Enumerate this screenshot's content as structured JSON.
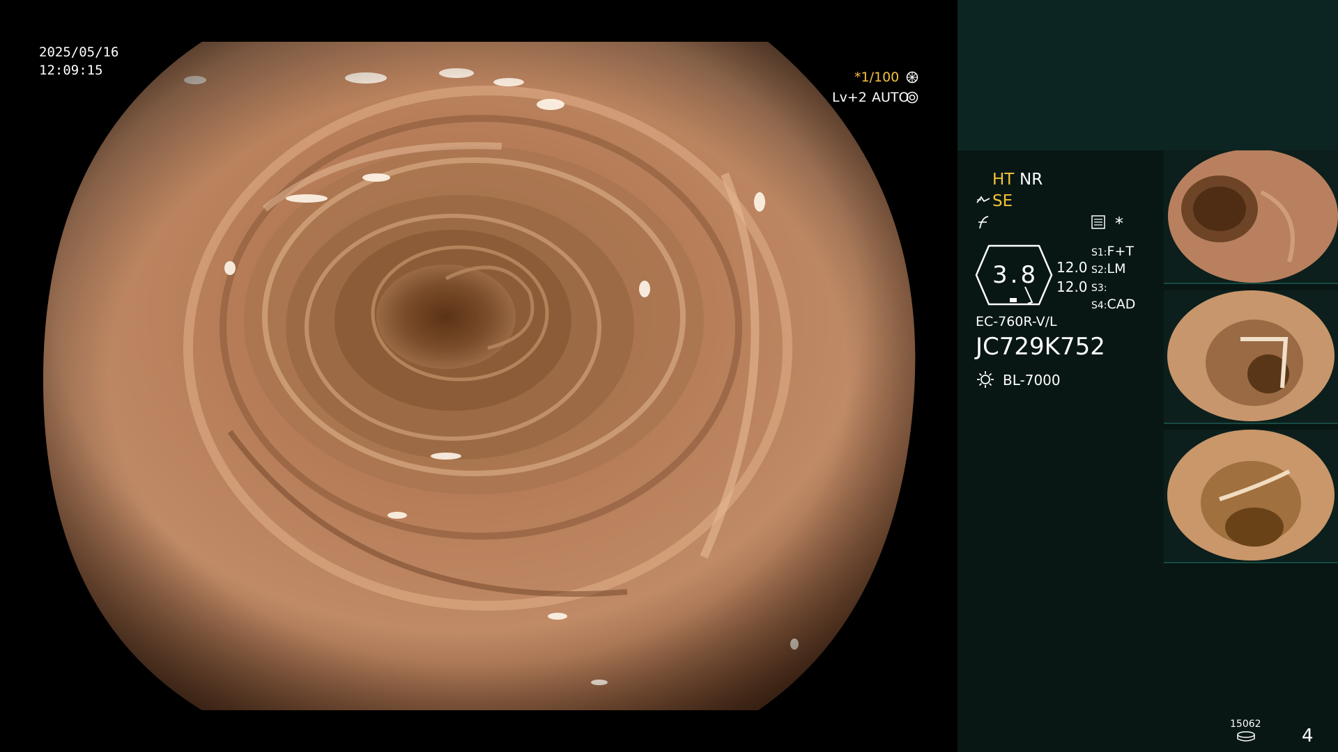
{
  "overlay": {
    "date": "2025/05/16",
    "time": "12:09:15",
    "shutter": "*1/100",
    "level": "Lv+2",
    "auto": "AUTO"
  },
  "modes": {
    "ht": "HT",
    "nr": "NR",
    "se": "SE"
  },
  "scope": {
    "dial_value": "3.8",
    "val_top": "12.0",
    "val_bottom": "12.0",
    "model": "EC-760R-V/L",
    "serial": "JC729K752",
    "light_source": "BL-7000",
    "asterisk": "*"
  },
  "switches": [
    {
      "key": "S1",
      "value": "F+T"
    },
    {
      "key": "S2",
      "value": "LM"
    },
    {
      "key": "S3",
      "value": ""
    },
    {
      "key": "S4",
      "value": "CAD"
    }
  ],
  "footer": {
    "counter": "15062",
    "page": "4"
  },
  "icons": {
    "shutter_wheel": "shutter-wheel-icon",
    "auto_iris": "auto-iris-icon",
    "structure": "structure-enhance-icon",
    "color": "color-tone-icon",
    "memo": "memo-icon",
    "light": "light-source-icon",
    "disk": "disk-icon"
  },
  "colors": {
    "accent": "#f5c23a",
    "panel_top": "#0d2522",
    "panel_bottom": "#081714"
  }
}
